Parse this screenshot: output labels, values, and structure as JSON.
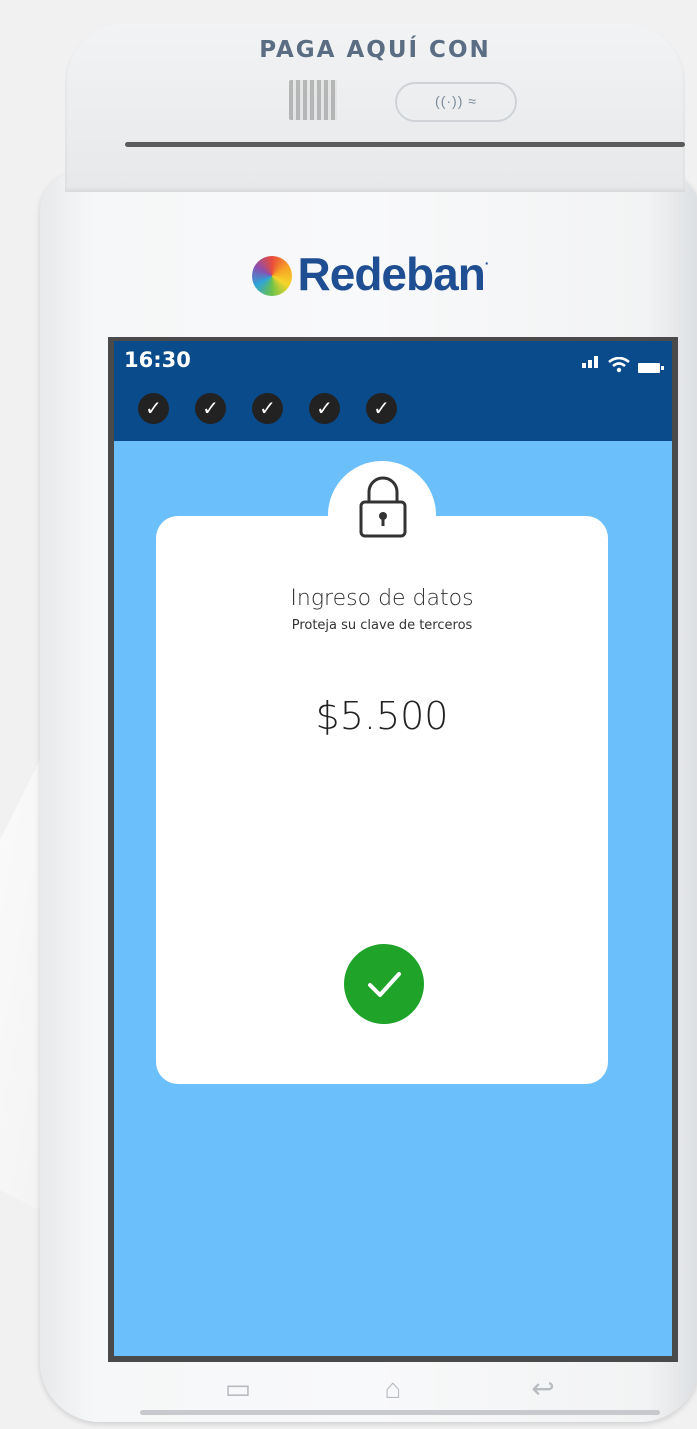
{
  "device": {
    "top_label": "PAGA AQUÍ CON",
    "contactless_label": "((·)) ≈",
    "brand": "Redeban",
    "brand_mark_suffix": "·"
  },
  "statusbar": {
    "time": "16:30",
    "icons": [
      "signal-icon",
      "wifi-icon",
      "battery-icon"
    ],
    "steps": [
      "✓",
      "✓",
      "✓",
      "✓",
      "✓"
    ]
  },
  "card": {
    "title": "Ingreso de datos",
    "subtitle": "Proteja su clave de terceros",
    "amount": "$5.500",
    "lock_icon": "lock-icon",
    "confirm_icon": "checkmark-icon"
  },
  "navkeys": {
    "recent": "▭",
    "home": "⌂",
    "back": "↩"
  },
  "colors": {
    "statusbar_bg": "#0a4b8c",
    "screen_bg": "#6bbffb",
    "confirm_green": "#1fa329",
    "brand_blue": "#1f4f92"
  }
}
